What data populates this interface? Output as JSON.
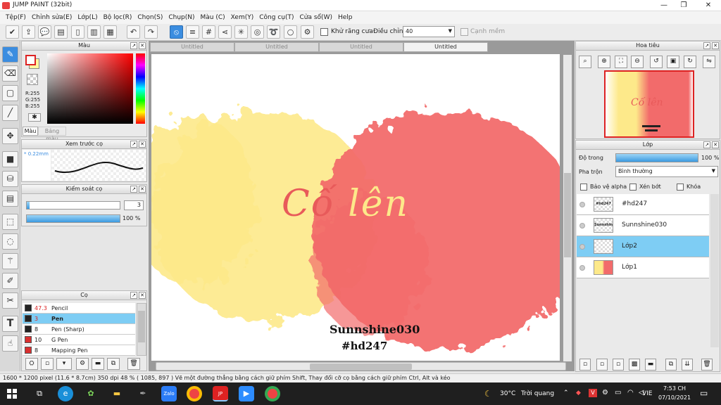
{
  "app": {
    "title": "JUMP PAINT (32bit)"
  },
  "menu": [
    "Tệp(F)",
    "Chỉnh sửa(E)",
    "Lớp(L)",
    "Bộ lọc(R)",
    "Chọn(S)",
    "Chụp(N)",
    "Màu (C)",
    "Xem(Y)",
    "Công cụ(T)",
    "Cửa sổ(W)",
    "Help"
  ],
  "toolbar": {
    "antialias_label": "Khử răng cưa",
    "adjust_label": "Điều chỉnh",
    "adjust_value": "40",
    "edge_label": "Cạnh mềm"
  },
  "color_panel": {
    "title": "Màu",
    "r": "R:255",
    "g": "G:255",
    "b": "B:255",
    "tab_color": "Màu",
    "tab_table": "Bảng màu",
    "fg_color": "#ffffff",
    "bg_color": "#fff8a0"
  },
  "brush_preview": {
    "title": "Xem trước cọ",
    "size": "* 0.22mm"
  },
  "brush_control": {
    "title": "Kiểm soát cọ",
    "size_value": "3",
    "opacity_value": "100 %",
    "size_fraction": 0.03,
    "opacity_fraction": 1.0
  },
  "brush_panel": {
    "title": "Cọ",
    "items": [
      {
        "size": "47.3",
        "name": "Pencil",
        "color": "#222222",
        "selected": false
      },
      {
        "size": "3",
        "name": "Pen",
        "color": "#222222",
        "selected": true
      },
      {
        "size": "8",
        "name": "Pen (Sharp)",
        "color": "#222222",
        "selected": false
      },
      {
        "size": "10",
        "name": "G Pen",
        "color": "#d93030",
        "selected": false
      },
      {
        "size": "8",
        "name": "Mapping Pen",
        "color": "#d93030",
        "selected": false
      }
    ]
  },
  "tabs": [
    "Untitled",
    "Untitled",
    "Untitled",
    "Untitled"
  ],
  "artwork": {
    "title": "Cố lên",
    "line1": "Sunnshine030",
    "line2": "#hd247",
    "yellow": "#fde98a",
    "red": "#f26b6b"
  },
  "navigator": {
    "title": "Hoa tiêu",
    "thumb_text": "Cố lên"
  },
  "layers": {
    "title": "Lớp",
    "opacity_label": "Độ trong",
    "opacity_value": "100 %",
    "opacity_fraction": 1.0,
    "blend_label": "Pha trộn",
    "blend_value": "Bình thường",
    "protect_alpha": "Bảo vệ alpha",
    "clip": "Xén bớt",
    "lock": "Khóa",
    "items": [
      {
        "name": "#hd247",
        "thumb_text": "#hd247",
        "selected": false
      },
      {
        "name": "Sunnshine030",
        "thumb_text": "Sunnshine030",
        "selected": false
      },
      {
        "name": "Lớp2",
        "thumb_text": "",
        "selected": true
      },
      {
        "name": "Lớp1",
        "thumb_text": "",
        "selected": false
      }
    ]
  },
  "status": "1600 * 1200 pixel   (11.6 * 8.7cm)   350 dpi   48 %   ( 1085, 897 )   Vẽ một đường thẳng bằng cách giữ phím Shift, Thay đổi cỡ cọ bằng cách giữ phím Ctrl, Alt và kéo",
  "taskbar": {
    "temp": "30°C",
    "weather": "Trời quang",
    "lang": "VIE",
    "time": "7:53 CH",
    "date": "07/10/2021"
  }
}
